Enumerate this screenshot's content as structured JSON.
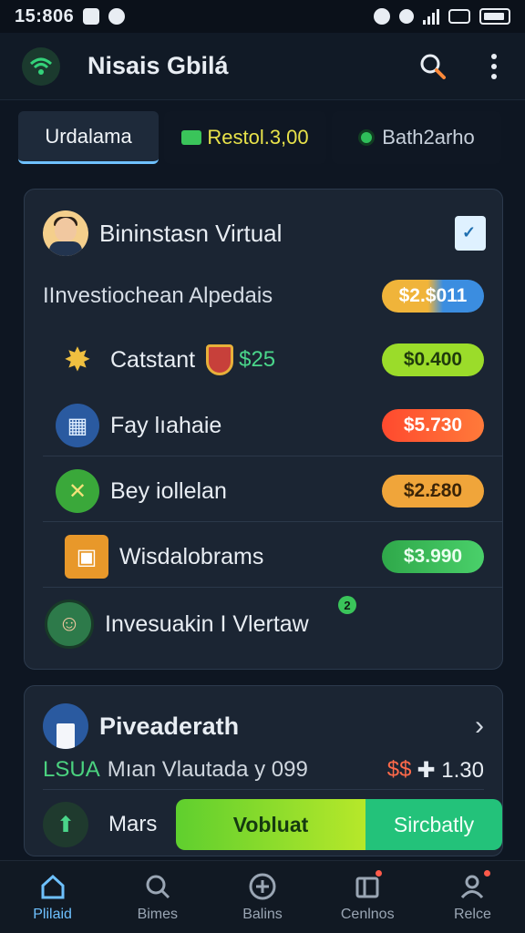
{
  "status": {
    "time": "15:806"
  },
  "appbar": {
    "title": "Nisais Gbilá"
  },
  "tabs": [
    {
      "label": "Urdalama"
    },
    {
      "label": "Restol.3,00"
    },
    {
      "label": "Bath2arho"
    }
  ],
  "card1": {
    "title": "Bininstasn Virtual",
    "rows": [
      {
        "label": "IInvestiochean Alpedais",
        "amount": "$2.$011",
        "color": "#f0b43a"
      },
      {
        "label": "Catstant",
        "extra": "$25",
        "amount": "$0.400",
        "color": "#9bdc2a"
      },
      {
        "label": "Fay lıahaie",
        "amount": "$5.730",
        "color": "#ff5a36"
      },
      {
        "label": "Bey iollelan",
        "amount": "$2.£80",
        "color": "#f0a53a"
      },
      {
        "label": "Wisdalobrams",
        "amount": "$3.990",
        "color": "#3ac45a"
      },
      {
        "label": "Invesuakin I Vlertaw",
        "badge": "2"
      }
    ]
  },
  "card2": {
    "title": "Piveaderath",
    "sub_green": "LSUA",
    "sub_text": "Mıan Vlautada y 099",
    "amount_red": "$$",
    "amount_rest": "✚ 1.30",
    "bottom_label": "Mars",
    "btn_primary": "Vobluat",
    "btn_secondary": "Sircbatly"
  },
  "nav": [
    {
      "label": "Plilaid",
      "icon": "home-icon"
    },
    {
      "label": "Bimes",
      "icon": "search-icon"
    },
    {
      "label": "Balins",
      "icon": "add-icon"
    },
    {
      "label": "Cenlnos",
      "icon": "wallet-icon"
    },
    {
      "label": "Relce",
      "icon": "profile-icon"
    }
  ]
}
